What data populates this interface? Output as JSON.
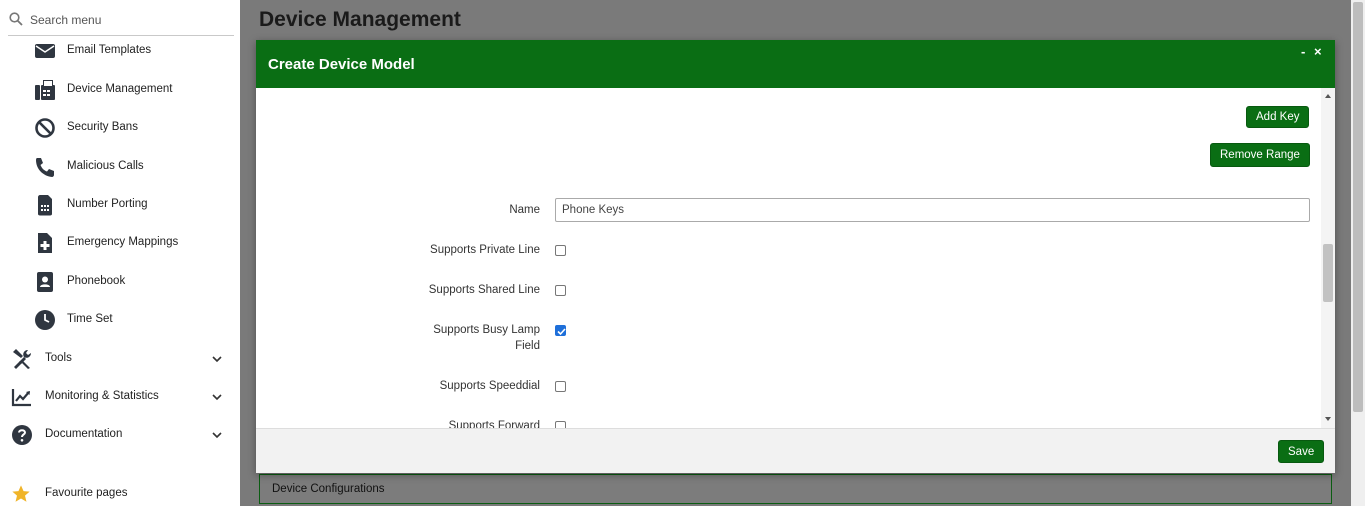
{
  "search": {
    "placeholder": "Search menu"
  },
  "sidebar": {
    "sub_items": [
      {
        "label": "Email Templates",
        "icon": "envelope-icon"
      },
      {
        "label": "Device Management",
        "icon": "fax-icon"
      },
      {
        "label": "Security Bans",
        "icon": "ban-icon"
      },
      {
        "label": "Malicious Calls",
        "icon": "phone-icon"
      },
      {
        "label": "Number Porting",
        "icon": "sim-card-icon"
      },
      {
        "label": "Emergency Mappings",
        "icon": "medical-file-icon"
      },
      {
        "label": "Phonebook",
        "icon": "address-book-icon"
      },
      {
        "label": "Time Set",
        "icon": "clock-icon"
      }
    ],
    "groups": [
      {
        "label": "Tools",
        "icon": "tools-icon"
      },
      {
        "label": "Monitoring & Statistics",
        "icon": "chart-line-icon"
      },
      {
        "label": "Documentation",
        "icon": "question-circle-icon"
      }
    ],
    "favourites": {
      "label": "Favourite pages",
      "icon": "star-icon"
    }
  },
  "page": {
    "title": "Device Management",
    "panel_label": "Device Configurations"
  },
  "modal": {
    "title": "Create Device Model",
    "minimize": "-",
    "close": "×",
    "add_key": "Add Key",
    "remove_range": "Remove Range",
    "fields": {
      "name_label": "Name",
      "name_value": "Phone Keys",
      "private_line": "Supports Private Line",
      "shared_line": "Supports Shared Line",
      "busy_lamp_line1": "Supports Busy Lamp",
      "busy_lamp_line2": "Field",
      "speeddial": "Supports Speeddial",
      "forward": "Supports Forward"
    },
    "checked": {
      "private_line": false,
      "shared_line": false,
      "busy_lamp": true,
      "speeddial": false,
      "forward": false
    },
    "save": "Save"
  },
  "colors": {
    "brand_green": "#0a6e14",
    "checkbox_blue": "#1e6fd9"
  }
}
